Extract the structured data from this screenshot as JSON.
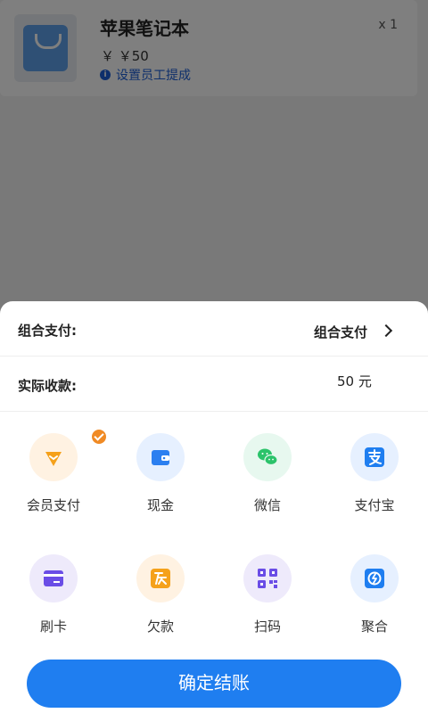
{
  "product": {
    "name": "苹果笔记本",
    "quantity": "x 1",
    "price": "￥ ￥50",
    "commission_link": "设置员工提成",
    "icon": "shopping-bag-icon"
  },
  "sheet": {
    "combo_label": "组合支付:",
    "combo_value": "组合支付",
    "received_label": "实际收款:",
    "received_value": "50 元"
  },
  "payment_methods": [
    {
      "label": "会员支付",
      "icon": "vip-member-icon",
      "selected": true
    },
    {
      "label": "现金",
      "icon": "wallet-icon",
      "selected": false
    },
    {
      "label": "微信",
      "icon": "wechat-icon",
      "selected": false
    },
    {
      "label": "支付宝",
      "icon": "alipay-icon",
      "selected": false
    },
    {
      "label": "刷卡",
      "icon": "card-icon",
      "selected": false
    },
    {
      "label": "欠款",
      "icon": "debt-icon",
      "selected": false
    },
    {
      "label": "扫码",
      "icon": "qr-scan-icon",
      "selected": false
    },
    {
      "label": "聚合",
      "icon": "aggregate-pay-icon",
      "selected": false
    }
  ],
  "confirm_button": "确定结账",
  "colors": {
    "primary": "#1f7ef0",
    "accent_orange": "#f08a24",
    "wechat_green": "#2bc36a"
  }
}
